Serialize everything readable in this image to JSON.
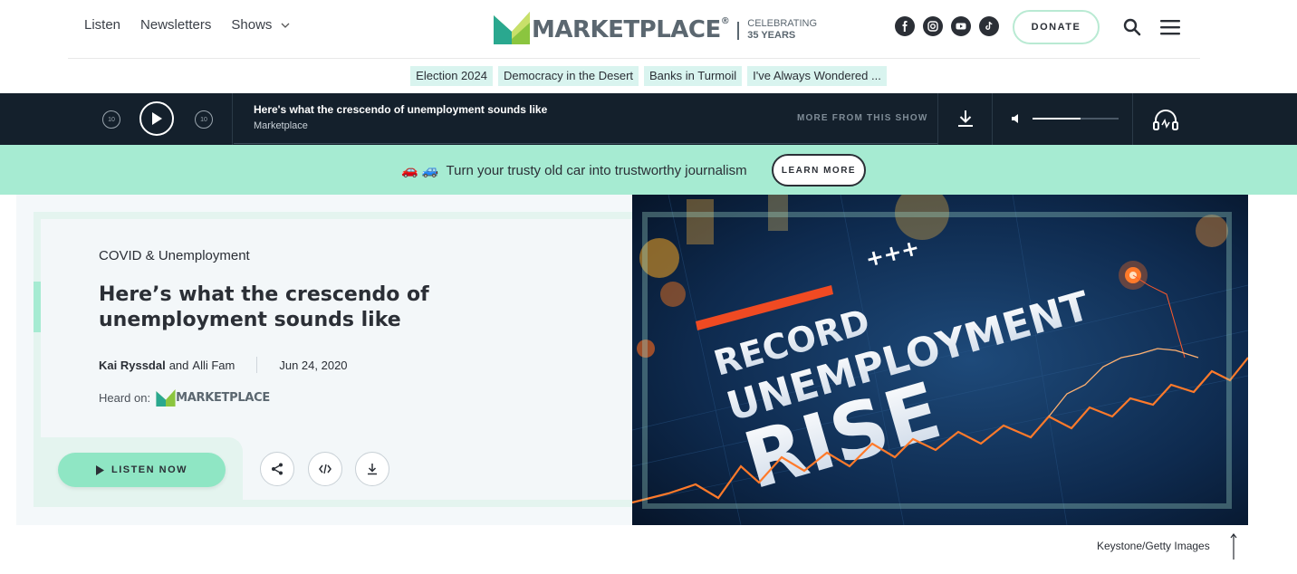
{
  "header": {
    "nav": [
      {
        "label": "Listen"
      },
      {
        "label": "Newsletters"
      },
      {
        "label": "Shows"
      }
    ],
    "logo_text": "MARKETPLACE",
    "logo_reg": "®",
    "celebrating_line1": "CELEBRATING",
    "celebrating_line2": "35 YEARS",
    "socials": [
      "facebook-icon",
      "instagram-icon",
      "youtube-icon",
      "tiktok-icon"
    ],
    "donate_label": "DONATE"
  },
  "topics": [
    "Election 2024",
    "Democracy in the Desert",
    "Banks in Turmoil",
    "I've Always Wondered ..."
  ],
  "player": {
    "title": "Here's what the crescendo of unemployment sounds like",
    "show": "Marketplace",
    "skip_seconds": "10",
    "more_label": "MORE FROM THIS SHOW",
    "volume_level": 0.56
  },
  "promo": {
    "text": "Turn your trusty old car into trustworthy journalism",
    "emoji": "🚗 🚙",
    "button_label": "LEARN MORE"
  },
  "article": {
    "category": "COVID & Unemployment",
    "headline": "Here’s what the crescendo of unemployment sounds like",
    "author1": "Kai Ryssdal",
    "and": "and",
    "author2": "Alli Fam",
    "date": "Jun 24, 2020",
    "heard_on": "Heard on:",
    "heard_logo": "MARKETPLACE",
    "listen_label": "LISTEN NOW"
  },
  "image": {
    "line1": "RECORD",
    "line2": "UNEMPLOYMENT",
    "line3": "RISE",
    "plus": "+++",
    "credit": "Keystone/Getty Images"
  },
  "colors": {
    "brand_green": "#8bc53f",
    "brand_teal": "#2aa88f",
    "promo_bg": "#a6ebd2",
    "player_bg": "#14202c",
    "topic_bg": "#d9f4ef"
  }
}
